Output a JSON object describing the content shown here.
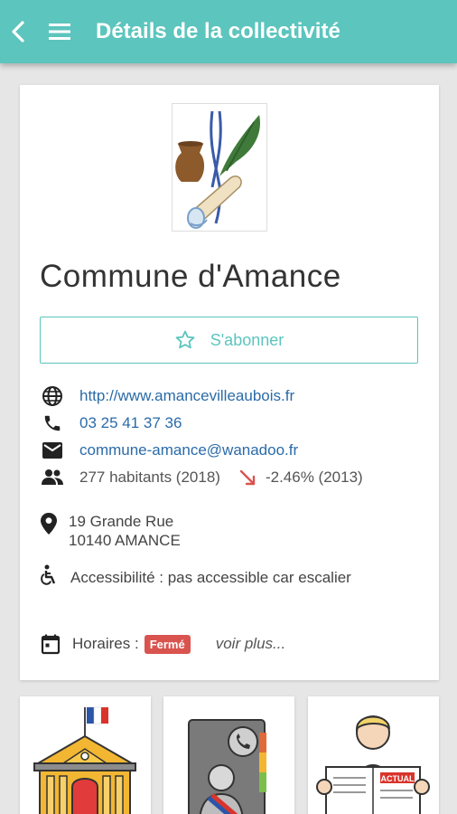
{
  "header": {
    "title": "Détails de la collectivité",
    "back_icon": "chevron-left-icon",
    "menu_icon": "hamburger-menu-icon",
    "background_color": "#5cc5bd"
  },
  "commune": {
    "name": "Commune d'Amance",
    "logo": "commune-coat-of-arms"
  },
  "subscribe": {
    "label": "S'abonner",
    "icon": "star-outline-icon",
    "color": "#5cc5bd"
  },
  "contact": {
    "website": "http://www.amancevilleaubois.fr",
    "phone": "03 25 41 37 36",
    "email": "commune-amance@wanadoo.fr",
    "population": "277 habitants (2018)",
    "trend": "-2.46% (2013)",
    "trend_color": "#d9534f"
  },
  "address": {
    "line1": "19 Grande Rue",
    "line2": "10140 AMANCE"
  },
  "accessibility": {
    "text": "Accessibilité : pas accessible car escalier"
  },
  "hours": {
    "label": "Horaires :",
    "status": "Fermé",
    "more": "voir plus..."
  },
  "tiles": [
    {
      "icon": "town-hall-icon"
    },
    {
      "icon": "mayor-directory-icon"
    },
    {
      "icon": "newspaper-reader-icon"
    }
  ]
}
